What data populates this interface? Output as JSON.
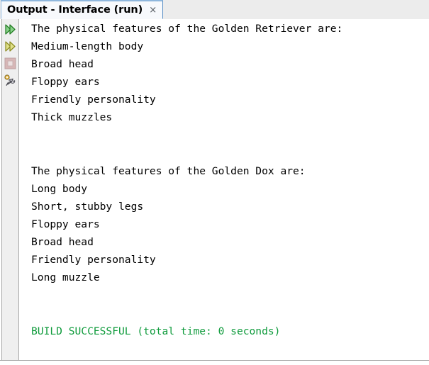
{
  "window": {
    "tab": {
      "label": "Output - Interface (run)",
      "close_label": "×",
      "active": true
    }
  },
  "toolbar": {
    "buttons": [
      {
        "name": "rerun-icon",
        "title": "Re-run",
        "color": "#2e9b2e"
      },
      {
        "name": "rerun-alternate-icon",
        "title": "Re-run with different parameters",
        "color": "#a8a82e"
      },
      {
        "name": "stop-icon",
        "title": "Stop",
        "color": "#c9a6a6"
      },
      {
        "name": "io-settings-icon",
        "title": "IO settings",
        "color": "#6b6b6b"
      }
    ]
  },
  "output": {
    "lines": [
      {
        "text": "The physical features of the Golden Retriever are:",
        "style": "normal"
      },
      {
        "text": "Medium-length body",
        "style": "normal"
      },
      {
        "text": "Broad head",
        "style": "normal"
      },
      {
        "text": "Floppy ears",
        "style": "normal"
      },
      {
        "text": "Friendly personality",
        "style": "normal"
      },
      {
        "text": "Thick muzzles",
        "style": "normal"
      },
      {
        "text": "",
        "style": "blank"
      },
      {
        "text": "",
        "style": "blank"
      },
      {
        "text": "The physical features of the Golden Dox are:",
        "style": "normal"
      },
      {
        "text": "Long body",
        "style": "normal"
      },
      {
        "text": "Short, stubby legs",
        "style": "normal"
      },
      {
        "text": "Floppy ears",
        "style": "normal"
      },
      {
        "text": "Broad head",
        "style": "normal"
      },
      {
        "text": "Friendly personality",
        "style": "normal"
      },
      {
        "text": "Long muzzle",
        "style": "normal"
      },
      {
        "text": "",
        "style": "blank"
      },
      {
        "text": "",
        "style": "blank"
      },
      {
        "text": "BUILD SUCCESSFUL (total time: 0 seconds)",
        "style": "success"
      }
    ],
    "success_color": "#0f9b3c",
    "text_color": "#000000"
  }
}
